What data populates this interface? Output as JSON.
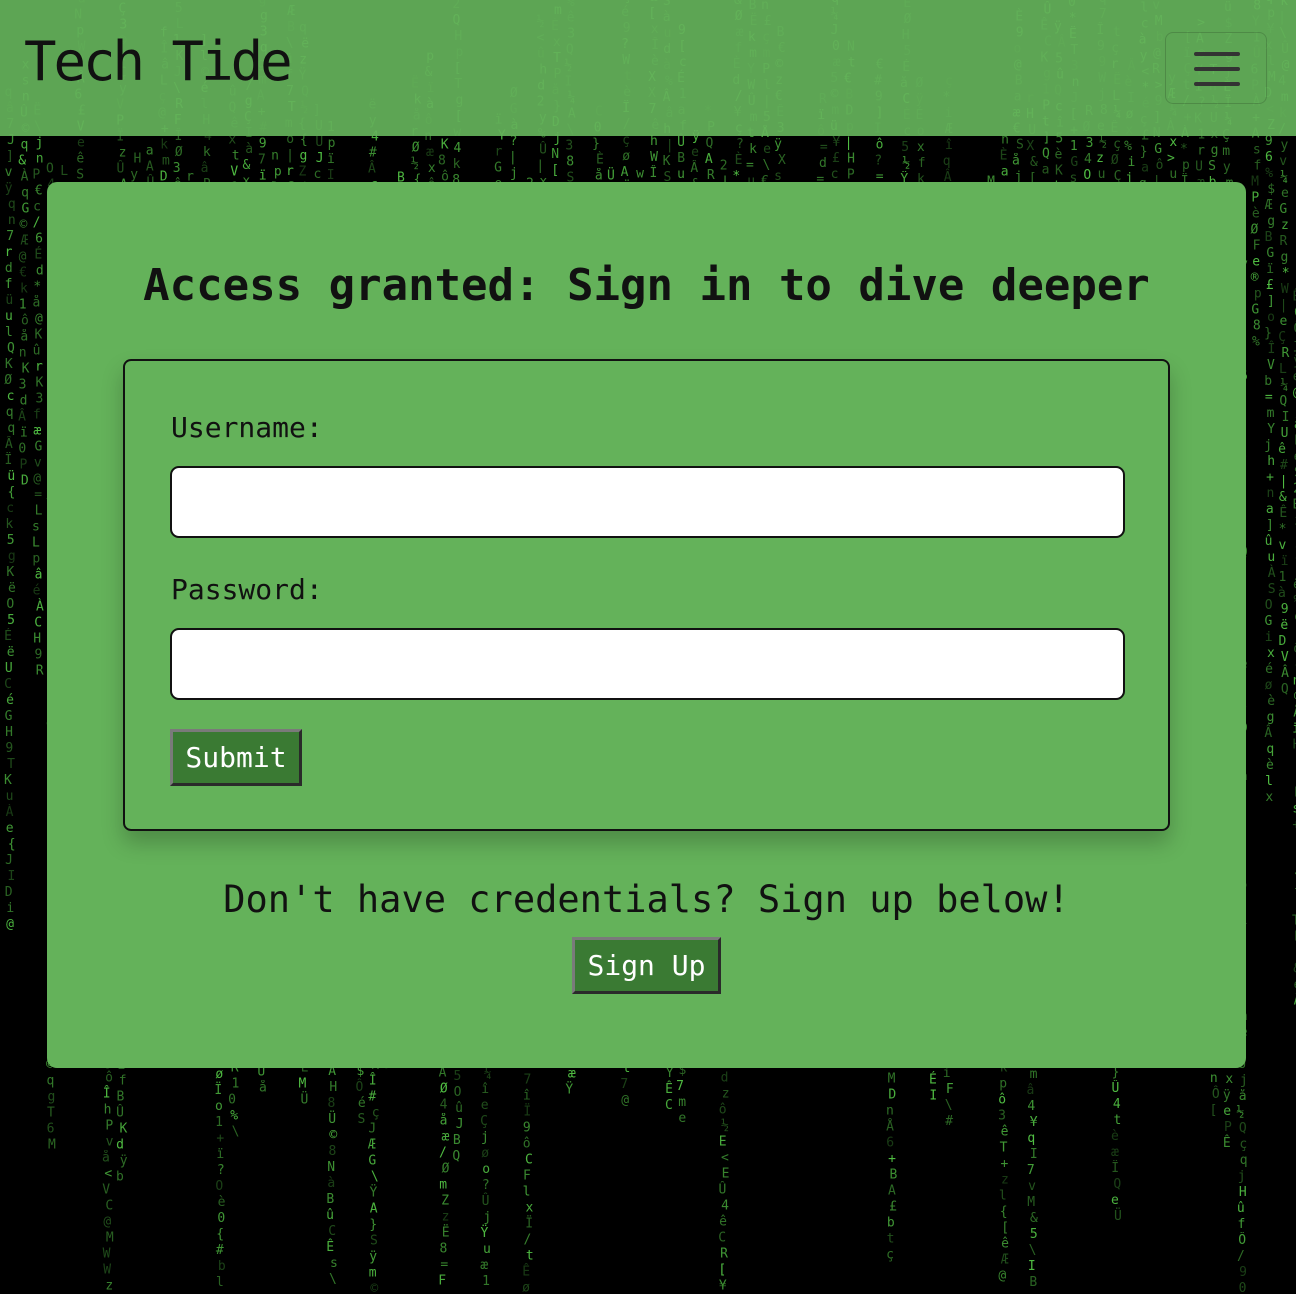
{
  "navbar": {
    "brand": "Tech Tide",
    "menu_toggle": "hamburger-menu-icon"
  },
  "login": {
    "heading": "Access granted: Sign in to dive deeper",
    "username_label": "Username:",
    "username_value": "",
    "password_label": "Password:",
    "password_value": "",
    "submit_label": "Submit"
  },
  "signup": {
    "prompt": "Don't have credentials? Sign up below!",
    "button_label": "Sign Up"
  },
  "colors": {
    "card_green": "#64b25a",
    "button_green": "#3a7a33",
    "matrix_green": "#5fe04f",
    "background": "#000000"
  }
}
